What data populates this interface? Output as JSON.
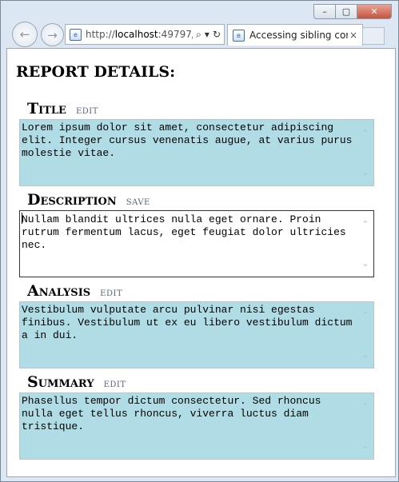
{
  "browser": {
    "url_prefix": "http://",
    "url_host": "localhost",
    "url_rest": ":49797/",
    "tab_title": "Accessing sibling cont...",
    "search_glyph": "⌕",
    "dropdown_glyph": "▾",
    "refresh_glyph": "↻",
    "close_tab_glyph": "×",
    "back_glyph": "←",
    "forward_glyph": "→",
    "minimize_glyph": "–",
    "maximize_glyph": "▢",
    "close_glyph": "✕"
  },
  "page": {
    "heading": "REPORT DETAILS:"
  },
  "sections": [
    {
      "title": "Title",
      "action": "edit",
      "text": "Lorem ipsum dolor sit amet, consectetur adipiscing elit. Integer cursus venenatis augue, at varius purus molestie vitae."
    },
    {
      "title": "Description",
      "action": "save",
      "text": "Nullam blandit ultrices nulla eget ornare. Proin rutrum fermentum lacus, eget feugiat dolor ultricies nec."
    },
    {
      "title": "Analysis",
      "action": "edit",
      "text": "Vestibulum vulputate arcu pulvinar nisi egestas finibus. Vestibulum ut ex eu libero vestibulum dictum a in dui."
    },
    {
      "title": "Summary",
      "action": "edit",
      "text": "Phasellus tempor dictum consectetur. Sed rhoncus nulla eget tellus rhoncus, viverra luctus diam tristique."
    }
  ],
  "colors": {
    "readonly_box": "#b0dde5",
    "editing_box": "#ffffff",
    "action_link": "#59657a"
  },
  "icons": {
    "scroll_up": "⌃",
    "scroll_down": "⌄"
  }
}
